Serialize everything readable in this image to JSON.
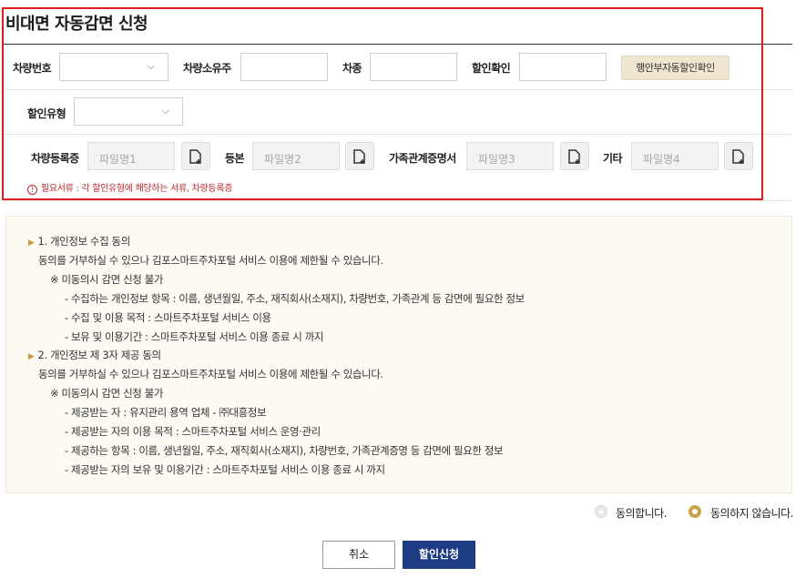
{
  "title": "비대면 자동감면 신청",
  "form": {
    "car_number_label": "차량번호",
    "car_number_value": "",
    "ownership_label": "차량소유주",
    "car_type_label": "차종",
    "discount_check_label": "할인확인",
    "mois_button": "행안부자동할인확인",
    "discount_type_label": "할인유형",
    "discount_type_value": "",
    "files": [
      {
        "label": "차량등록증",
        "placeholder": "파일명1"
      },
      {
        "label": "등본",
        "placeholder": "파일명2"
      },
      {
        "label": "가족관계증명서",
        "placeholder": "파일명3"
      },
      {
        "label": "기타",
        "placeholder": "파일명4"
      }
    ],
    "notice": "필요서류 : 각 할인유형에 해당하는 서류, 차량등록증"
  },
  "terms": {
    "s1_title": "1. 개인정보 수집 동의",
    "s1_desc": "동의를 거부하실 수 있으나 김포스마트주차포털 서비스 이용에 제한될 수 있습니다.",
    "s1_note": "※ 미동의시 감면 신청 불가",
    "s1_items": [
      "- 수집하는 개인정보 항목 : 이름, 생년월일, 주소, 재직회사(소재지), 차량번호, 가족관계 등 감면에 필요한 정보",
      "- 수집 및 이용 목적 : 스마트주차포털 서비스 이용",
      "- 보유 및 이용기간 : 스마트주차포털 서비스 이용 종료 시 까지"
    ],
    "s2_title": "2. 개인정보 제 3자 제공 동의",
    "s2_desc": "동의를 거부하실 수 있으나 김포스마트주차포털 서비스 이용에 제한될 수 있습니다.",
    "s2_note": "※ 미동의시 감면 신청 불가",
    "s2_items": [
      "- 제공받는 자 : 유지관리 용역 업체 - ㈜대흥정보",
      "- 제공받는 자의 이용 목적 : 스마트주차포털 서비스 운영·관리",
      "- 제공하는 항목 : 이름, 생년월일, 주소, 재직회사(소재지), 차량번호, 가족관계증명 등 감면에 필요한 정보",
      "- 제공받는 자의 보유 및 이용기간 : 스마트주차포털 서비스 이용 종료 시 까지"
    ]
  },
  "consent": {
    "agree_label": "동의합니다.",
    "disagree_label": "동의하지 않습니다.",
    "selected": "disagree"
  },
  "buttons": {
    "cancel": "취소",
    "apply": "할인신청"
  },
  "colors": {
    "accent_red": "#e01b1b",
    "primary_navy": "#1d3c84",
    "gold": "#c9a24a"
  }
}
